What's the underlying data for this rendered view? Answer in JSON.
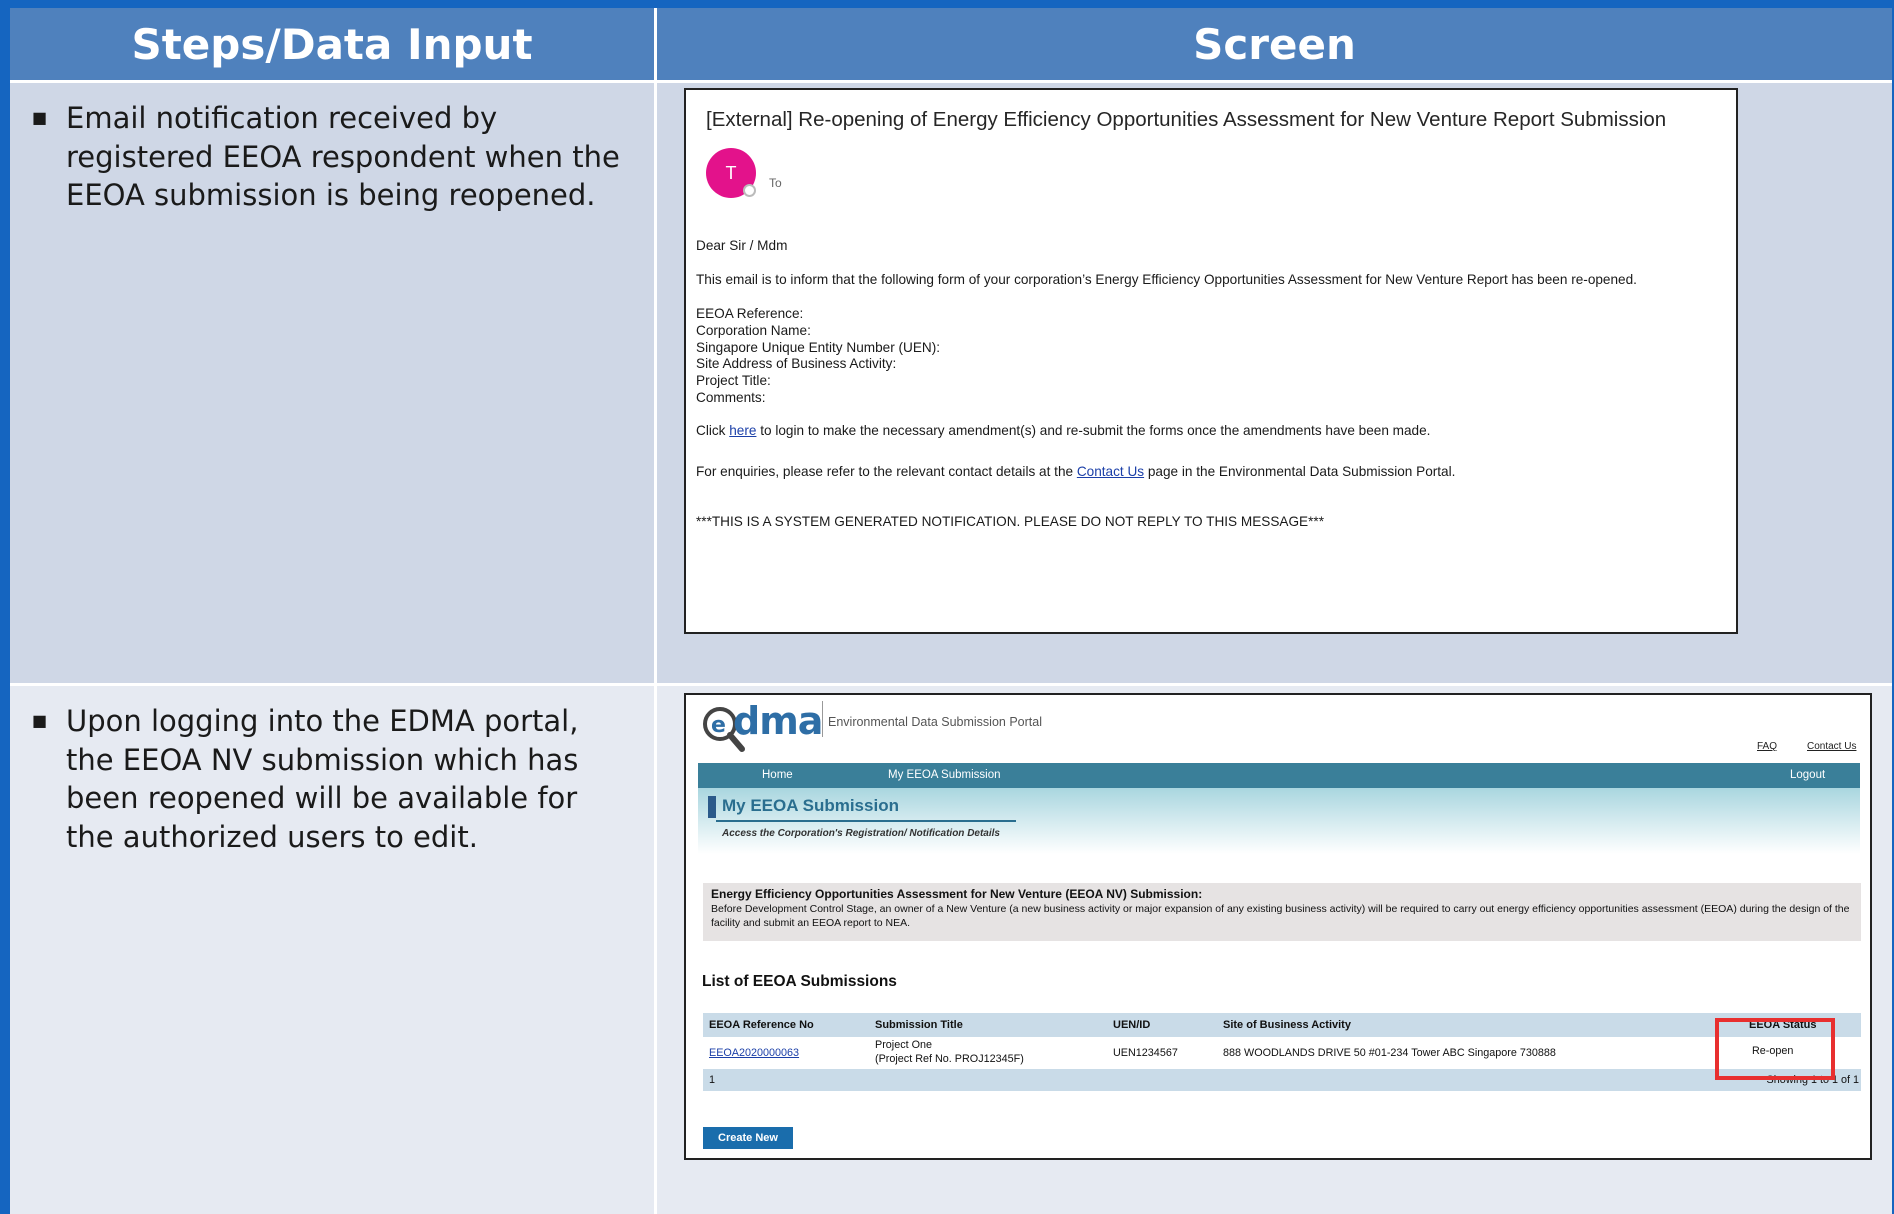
{
  "headers": {
    "left": "Steps/Data Input",
    "right": "Screen"
  },
  "steps": [
    "Email notification received by registered EEOA respondent when the EEOA submission is being reopened.",
    "Upon logging into the EDMA portal, the EEOA NV submission which has been reopened will be available for the authorized users to edit."
  ],
  "email": {
    "subject": "[External] Re-opening of Energy Efficiency Opportunities Assessment for New Venture Report Submission",
    "avatar_initial": "T",
    "to_label": "To",
    "greeting": "Dear Sir / Mdm",
    "intro": "This email is to inform that the following form of your corporation’s Energy Efficiency Opportunities Assessment for New Venture Report has been re-opened.",
    "fields": [
      "EEOA Reference:",
      "Corporation Name:",
      "Singapore Unique Entity Number (UEN):",
      "Site Address of Business Activity:",
      "Project Title:",
      "Comments:"
    ],
    "click_prefix": "Click ",
    "click_link": "here",
    "click_suffix": " to login to make the necessary amendment(s) and re-submit the forms once the amendments have been made.",
    "enquiry_prefix": "For enquiries, please refer to the relevant contact details at the ",
    "enquiry_link": "Contact Us",
    "enquiry_suffix": " page in the Environmental Data Submission Portal.",
    "footer": "***THIS IS A SYSTEM GENERATED NOTIFICATION. PLEASE DO NOT REPLY TO THIS MESSAGE***"
  },
  "portal": {
    "logo_text": "edma",
    "name": "Environmental Data Submission Portal",
    "top_links": [
      "FAQ",
      "Contact Us"
    ],
    "nav": {
      "home": "Home",
      "my_submission": "My EEOA Submission",
      "logout": "Logout"
    },
    "banner_title": "My EEOA Submission",
    "banner_sub": "Access the Corporation's Registration/ Notification Details",
    "info_heading": "Energy Efficiency Opportunities Assessment for New Venture (EEOA NV) Submission:",
    "info_text": "Before Development Control Stage, an owner of a New Venture (a new business activity or major expansion of any existing business activity) will be required to carry out energy efficiency opportunities assessment (EEOA) during the design of the facility and submit an EEOA report to NEA.",
    "list_title": "List of EEOA Submissions",
    "columns": [
      "EEOA Reference No",
      "Submission Title",
      "UEN/ID",
      "Site of Business Activity",
      "EEOA Status"
    ],
    "rows": [
      {
        "ref": "EEOA2020000063",
        "title_line1": "Project One",
        "title_line2": "(Project Ref No. PROJ12345F)",
        "uen": "UEN1234567",
        "site": "888 WOODLANDS DRIVE 50 #01-234 Tower ABC Singapore 730888",
        "status": "Re-open"
      }
    ],
    "page_number": "1",
    "showing": "Showing 1 to 1 of 1",
    "create_button": "Create New"
  }
}
